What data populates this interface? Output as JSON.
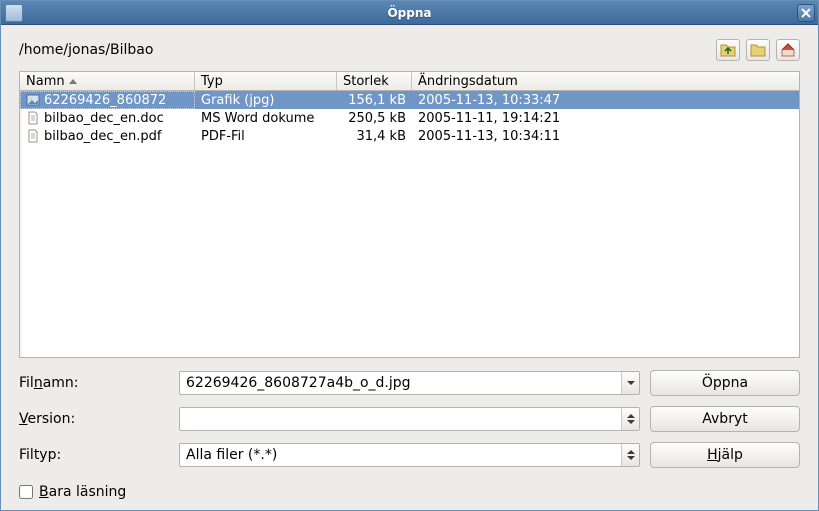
{
  "window": {
    "title": "Öppna"
  },
  "path": "/home/jonas/Bilbao",
  "columns": {
    "name": "Namn",
    "type": "Typ",
    "size": "Storlek",
    "date": "Ändringsdatum"
  },
  "files": [
    {
      "name": "62269426_860872",
      "type": "Grafik (jpg)",
      "size": "156,1 kB",
      "date": "2005-11-13, 10:33:47",
      "selected": true,
      "icon": "image"
    },
    {
      "name": "bilbao_dec_en.doc",
      "type": "MS Word dokume",
      "size": "250,5 kB",
      "date": "2005-11-11, 19:14:21",
      "selected": false,
      "icon": "doc"
    },
    {
      "name": "bilbao_dec_en.pdf",
      "type": "PDF-Fil",
      "size": "31,4 kB",
      "date": "2005-11-13, 10:34:11",
      "selected": false,
      "icon": "doc"
    }
  ],
  "form": {
    "filename_label": "Filnamn:",
    "filename_u": "n",
    "filename_value": "62269426_8608727a4b_o_d.jpg",
    "version_label": "Version:",
    "version_u": "V",
    "version_value": "",
    "filetype_label": "Filtyp:",
    "filetype_value": "Alla filer (*.*)"
  },
  "buttons": {
    "open": "Öppna",
    "cancel": "Avbryt",
    "help": "Hjälp",
    "help_u": "H"
  },
  "readonly": {
    "label_before": "B",
    "label_after": "ara läsning"
  }
}
